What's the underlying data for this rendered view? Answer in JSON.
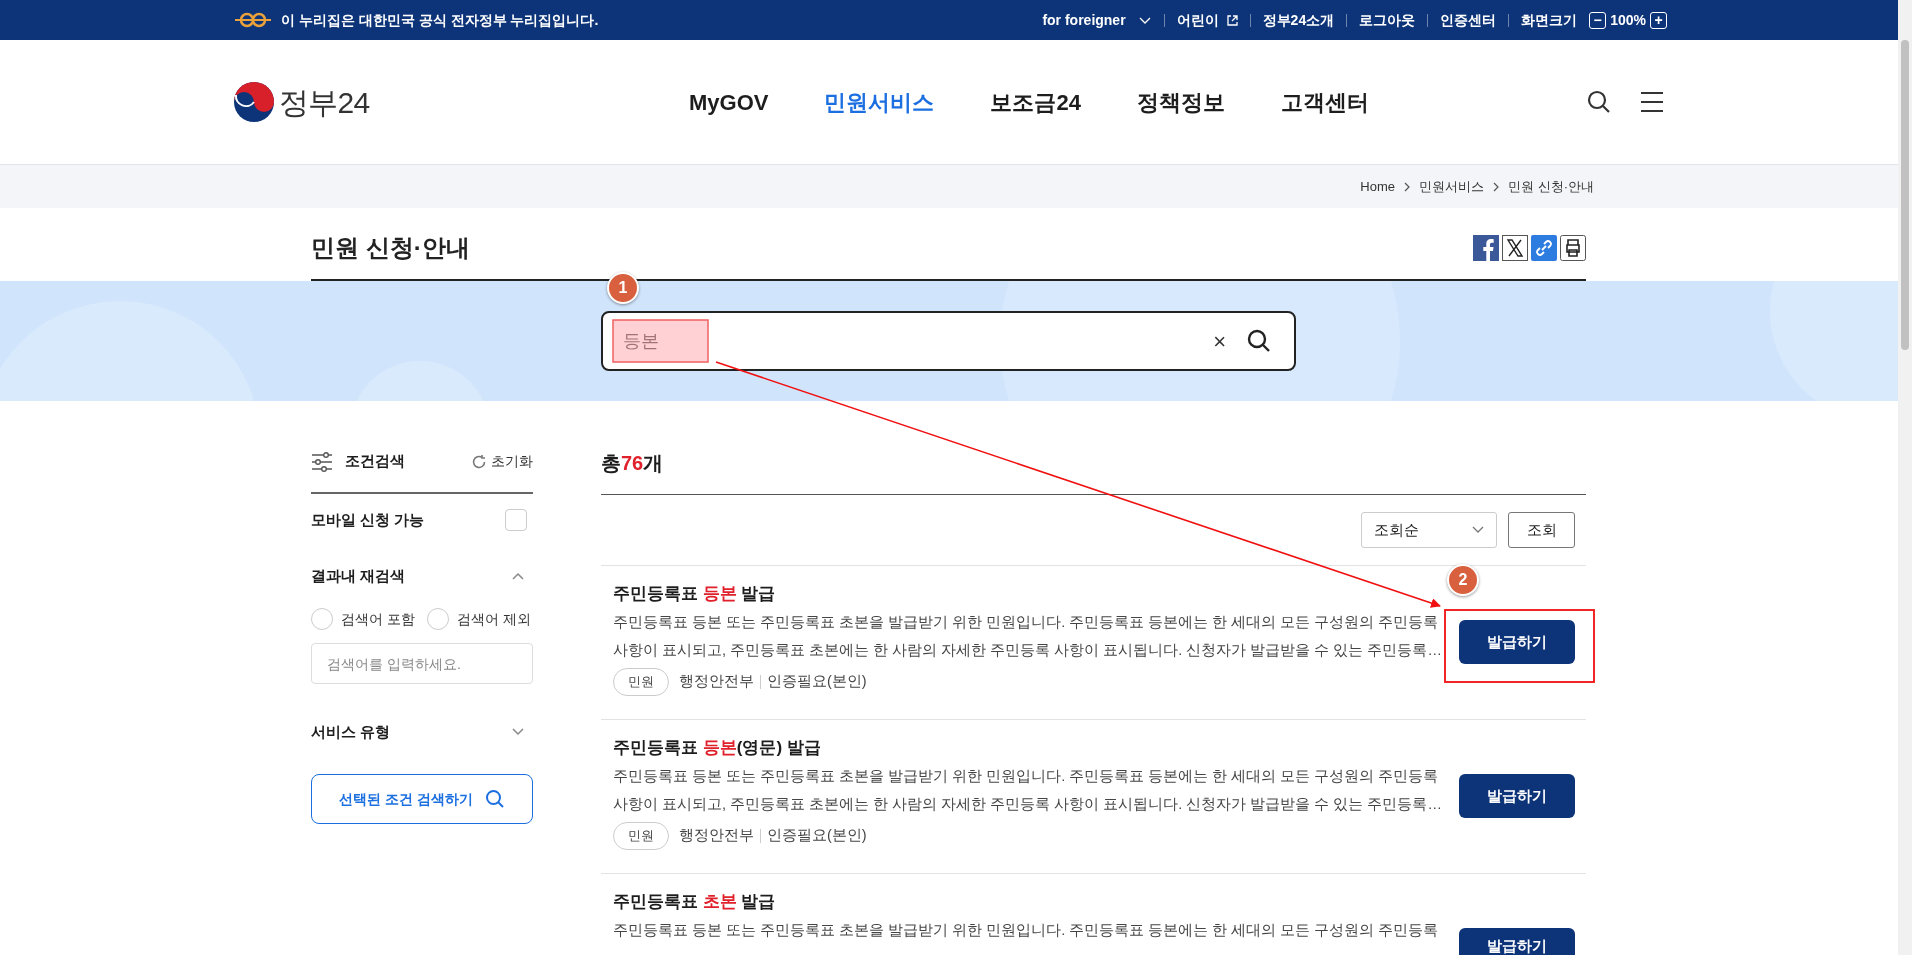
{
  "top_bar": {
    "notice": "이 누리집은 대한민국 공식 전자정부 누리집입니다.",
    "links": [
      {
        "label": "for foreigner",
        "kind": "dropdown"
      },
      {
        "label": "어린이",
        "kind": "external"
      },
      {
        "label": "정부24소개",
        "kind": "plain"
      },
      {
        "label": "로그아웃",
        "kind": "plain"
      },
      {
        "label": "인증센터",
        "kind": "plain"
      },
      {
        "label": "화면크기",
        "kind": "plain"
      }
    ],
    "zoom": {
      "minus": "−",
      "value": "100%",
      "plus": "+"
    }
  },
  "header": {
    "logo": "정부24",
    "nav": [
      {
        "label": "MyGOV",
        "selected": false
      },
      {
        "label": "민원서비스",
        "selected": true
      },
      {
        "label": "보조금24",
        "selected": false
      },
      {
        "label": "정책정보",
        "selected": false
      },
      {
        "label": "고객센터",
        "selected": false
      }
    ]
  },
  "breadcrumb": [
    "Home",
    "민원서비스",
    "민원 신청·안내"
  ],
  "page_title": "민원 신청·안내",
  "search": {
    "value": "등본",
    "clear": "×"
  },
  "filters": {
    "title": "조건검색",
    "reset": "초기화",
    "mobile": {
      "label": "모바일 신청 가능",
      "checked": false
    },
    "refine": {
      "label": "결과내 재검색",
      "expanded": true,
      "options": [
        {
          "label": "검색어 포함",
          "selected": false
        },
        {
          "label": "검색어 제외",
          "selected": false
        }
      ],
      "placeholder": "검색어를 입력하세요."
    },
    "service_type": {
      "label": "서비스 유형",
      "expanded": false
    },
    "submit": "선택된 조건 검색하기"
  },
  "results": {
    "total_prefix": "총 ",
    "total_count": "76",
    "total_suffix": "개",
    "sort": "조회순",
    "sort_button": "조회",
    "items": [
      {
        "title_before": "주민등록표 ",
        "title_highlight": "등본",
        "title_after": " 발급",
        "description": [
          "주민등록표 등본 또는 주민등록표 초본을 발급받기 위한 민원입니다. 주민등록표 등본에는 한 세대의 모든 구성원의 주민등록",
          "사항이 표시되고, 주민등록표 초본에는 한 사람의 자세한 주민등록 사항이 표시됩니다. 신청자가 발급받을 수 있는 주민등록…"
        ],
        "tag": "민원",
        "agency": "행정안전부",
        "auth": "인증필요(본인)",
        "button": "발급하기"
      },
      {
        "title_before": "주민등록표 ",
        "title_highlight": "등본",
        "title_after": "(영문) 발급",
        "description": [
          "주민등록표 등본 또는 주민등록표 초본을 발급받기 위한 민원입니다. 주민등록표 등본에는 한 세대의 모든 구성원의 주민등록",
          "사항이 표시되고, 주민등록표 초본에는 한 사람의 자세한 주민등록 사항이 표시됩니다. 신청자가 발급받을 수 있는 주민등록…"
        ],
        "tag": "민원",
        "agency": "행정안전부",
        "auth": "인증필요(본인)",
        "button": "발급하기"
      },
      {
        "title_before": "주민등록표 ",
        "title_highlight": "초본",
        "title_after": " 발급",
        "description": [
          "주민등록표 등본 또는 주민등록표 초본을 발급받기 위한 민원입니다. 주민등록표 등본에는 한 세대의 모든 구성원의 주민등록"
        ],
        "button": "발급하기"
      }
    ]
  },
  "annotations": [
    {
      "number": "1"
    },
    {
      "number": "2"
    }
  ]
}
